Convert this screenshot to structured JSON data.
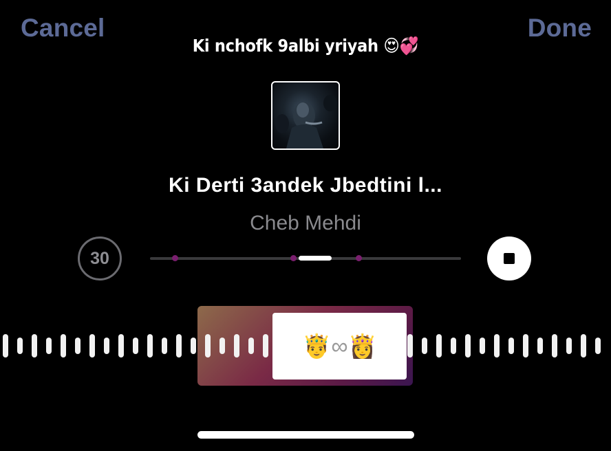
{
  "header": {
    "cancel_label": "Cancel",
    "done_label": "Done",
    "caption": "Ki nchofk 9albi yriyah 😍💞"
  },
  "track": {
    "title": "Ki Derti 3andek Jbedtini l...",
    "artist": "Cheb Mehdi"
  },
  "controls": {
    "duration_label": "30",
    "stop_icon": "stop-icon",
    "scrubber_position": 0.53,
    "scrubber_markers": [
      0.08,
      0.46,
      0.67
    ]
  },
  "clip_selector": {
    "sticker_text": "🤴∞👸"
  },
  "colors": {
    "accent_blue": "#5c6a96",
    "secondary_text": "#8a8a8e",
    "marker": "#7a1f6e"
  }
}
